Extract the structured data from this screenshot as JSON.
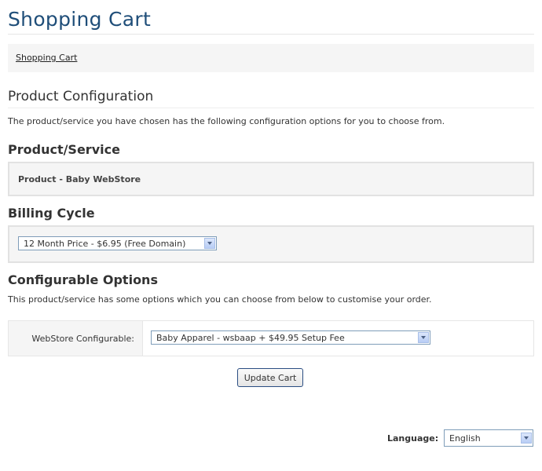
{
  "header": {
    "title": "Shopping Cart"
  },
  "breadcrumb": {
    "link": "Shopping Cart"
  },
  "product_configuration": {
    "heading": "Product Configuration",
    "intro": "The product/service you have chosen has the following configuration options for you to choose from."
  },
  "product_service": {
    "heading": "Product/Service",
    "name": "Product - Baby WebStore"
  },
  "billing_cycle": {
    "heading": "Billing Cycle",
    "selected": "12 Month Price - $6.95 (Free Domain)"
  },
  "configurable_options": {
    "heading": "Configurable Options",
    "intro": "This product/service has some options which you can choose from below to customise your order.",
    "rows": [
      {
        "label": "WebStore Configurable:",
        "selected": "Baby Apparel - wsbaap + $49.95 Setup Fee"
      }
    ]
  },
  "actions": {
    "update_label": "Update Cart"
  },
  "language": {
    "label": "Language:",
    "selected": "English"
  },
  "colors": {
    "title": "#1f4e79",
    "panel_bg": "#f5f5f5",
    "panel_border": "#e2e2e2",
    "button_border": "#2a4d82"
  }
}
